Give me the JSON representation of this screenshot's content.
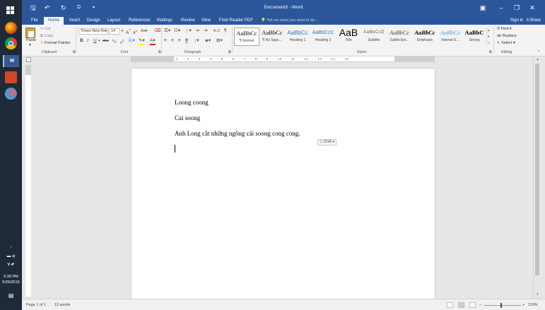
{
  "window": {
    "doc_title": "Document3 - Word",
    "qat": {
      "save_icon": "save-icon",
      "undo_icon": "undo-icon",
      "redo_icon": "redo-icon",
      "touch_icon": "touch-mode-icon"
    },
    "controls": {
      "ribbon_display": "▣",
      "minimize": "–",
      "restore": "❐",
      "close": "✕"
    }
  },
  "tabs": [
    "File",
    "Home",
    "Insert",
    "Design",
    "Layout",
    "References",
    "Mailings",
    "Review",
    "View",
    "Foxit Reader PDF"
  ],
  "active_tab": "Home",
  "tell_me": "Tell me what you want to do...",
  "account": {
    "signin": "Sign in",
    "share": "Share"
  },
  "ribbon": {
    "clipboard": {
      "label": "Clipboard",
      "paste": "Paste",
      "cut": "Cut",
      "copy": "Copy",
      "format_painter": "Format Painter"
    },
    "font": {
      "label": "Font",
      "name": "Times New Ro",
      "size": "14"
    },
    "paragraph": {
      "label": "Paragraph"
    },
    "styles": {
      "label": "Styles",
      "items": [
        {
          "sample": "AaBbCc",
          "name": "¶ Normal"
        },
        {
          "sample": "AaBbCc",
          "name": "¶ No Spac..."
        },
        {
          "sample": "AaBbCc",
          "name": "Heading 1"
        },
        {
          "sample": "AaBbCcC",
          "name": "Heading 2"
        },
        {
          "sample": "AaB",
          "name": "Title"
        },
        {
          "sample": "AaBbCcD",
          "name": "Subtitle"
        },
        {
          "sample": "AaBbCc",
          "name": "Subtle Em..."
        },
        {
          "sample": "AaBbCc",
          "name": "Emphasis"
        },
        {
          "sample": "AaBbCc",
          "name": "Intense E..."
        },
        {
          "sample": "AaBbC",
          "name": "Strong"
        }
      ]
    },
    "editing": {
      "label": "Editing",
      "find": "Find",
      "replace": "Replace",
      "select": "Select"
    }
  },
  "document": {
    "paragraphs": [
      "Loong coong",
      "Cai soong",
      "Anh Long cắt những ngồng cải soong cong cong."
    ],
    "paste_options": "(Ctrl)"
  },
  "taskbar": {
    "time": "5:39 PM",
    "date": "5/25/2019"
  },
  "status": {
    "page": "Page 1 of 1",
    "words": "13 words",
    "zoom": "110%"
  },
  "colors": {
    "accent": "#2b579a",
    "taskbar": "#1f2a38",
    "ribbon_bg": "#f3f3f3"
  }
}
